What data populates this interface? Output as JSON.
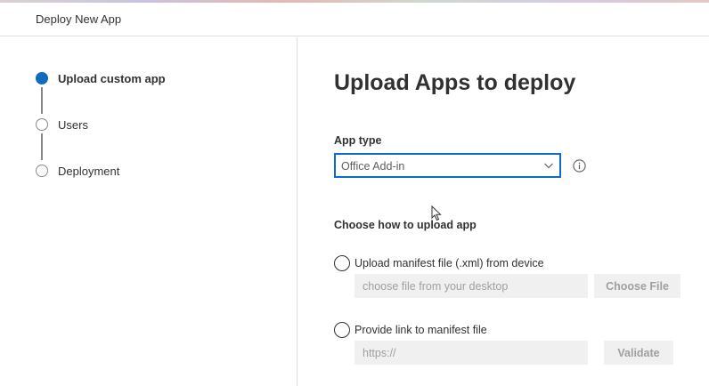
{
  "header": {
    "title": "Deploy New App"
  },
  "wizard": {
    "steps": [
      {
        "label": "Upload custom app",
        "state": "active"
      },
      {
        "label": "Users",
        "state": "pending"
      },
      {
        "label": "Deployment",
        "state": "pending"
      }
    ]
  },
  "main": {
    "title": "Upload Apps to deploy",
    "app_type": {
      "label": "App type",
      "selected": "Office Add-in",
      "chevron_icon": "chevron-down-icon",
      "info_icon": "info-icon"
    },
    "upload_method": {
      "label": "Choose how to upload app",
      "options": [
        {
          "label": "Upload manifest file (.xml) from device",
          "placeholder": "choose file from your desktop",
          "button": "Choose File"
        },
        {
          "label": "Provide link to manifest file",
          "placeholder": "https://",
          "button": "Validate"
        }
      ]
    }
  },
  "colors": {
    "accent": "#0f6cbd",
    "disabled_bg": "#f0f0f0",
    "disabled_text": "#a19f9d",
    "border": "#e1dfdd"
  }
}
